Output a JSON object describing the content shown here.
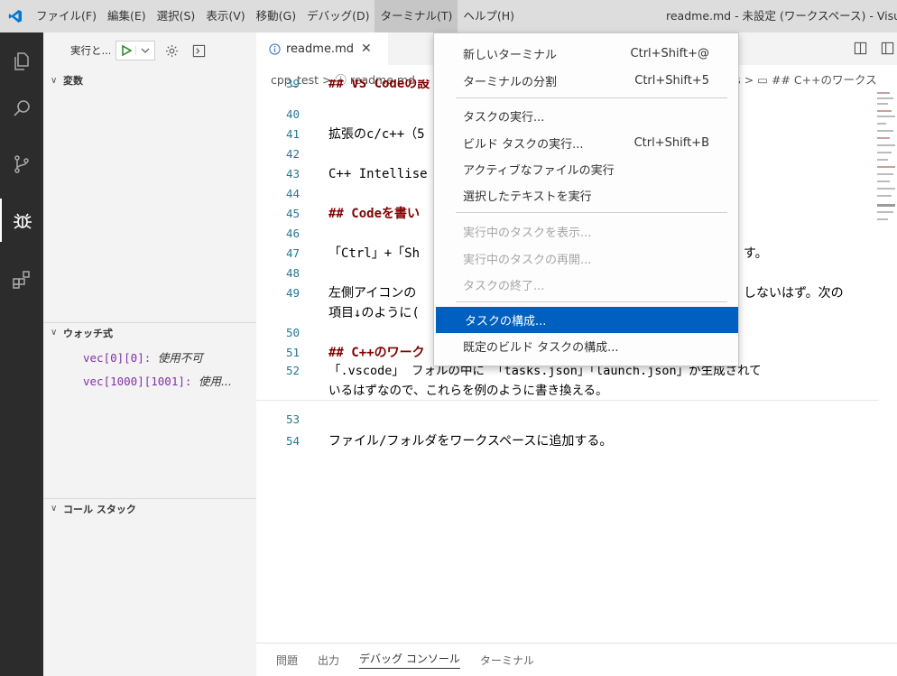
{
  "menubar": {
    "items": [
      "ファイル(F)",
      "編集(E)",
      "選択(S)",
      "表示(V)",
      "移動(G)",
      "デバッグ(D)",
      "ターミナル(T)",
      "ヘルプ(H)"
    ],
    "window_title": "readme.md - 未設定 (ワークスペース) - Visu"
  },
  "sidebar": {
    "run_label": "実行と...",
    "sections": {
      "variables": "変数",
      "watch": "ウォッチ式",
      "callstack": "コール スタック"
    },
    "watch_items": [
      {
        "expr": "vec[0][0]:",
        "value": "使用不可"
      },
      {
        "expr": "vec[1000][1001]:",
        "value": "使用..."
      }
    ]
  },
  "editor": {
    "tab_label": "readme.md",
    "breadcrumb_left": "cpp_test > ⓘ readme.md",
    "breadcrumb_right": "ws > ▭ ## C++のワークス",
    "lines": [
      {
        "n": "39",
        "t": "## VS Codeの設"
      },
      {
        "n": "40",
        "t": ""
      },
      {
        "n": "41",
        "t": "拡張のc/c++（5"
      },
      {
        "n": "42",
        "t": ""
      },
      {
        "n": "43",
        "t": "C++ Intellise"
      },
      {
        "n": "44",
        "t": ""
      },
      {
        "n": "45",
        "t": "## Codeを書い"
      },
      {
        "n": "46",
        "t": ""
      },
      {
        "n": "47",
        "t": "「Ctrl」+「Sh",
        "tail": "す。"
      },
      {
        "n": "48",
        "t": ""
      },
      {
        "n": "49",
        "t": "左側アイコンの",
        "tail": "しないはず。次の"
      },
      {
        "n": "",
        "t": "項目↓のように("
      },
      {
        "n": "50",
        "t": ""
      },
      {
        "n": "51",
        "t": "## C++のワーク"
      },
      {
        "n": "52",
        "t": "「.vscode」 フォルの中に 「tasks.json」「launch.json」が生成されて"
      },
      {
        "n": "",
        "t": "いるはずなので、これらを例のように書き換える。"
      },
      {
        "n": "53",
        "t": ""
      },
      {
        "n": "54",
        "t": "ファイル/フォルダをワークスペースに追加する。"
      }
    ]
  },
  "panel_tabs": [
    "問題",
    "出力",
    "デバッグ コンソール",
    "ターミナル"
  ],
  "dropdown": {
    "items": [
      {
        "label": "新しいターミナル",
        "shortcut": "Ctrl+Shift+@"
      },
      {
        "label": "ターミナルの分割",
        "shortcut": "Ctrl+Shift+5"
      },
      {
        "label": "タスクの実行...",
        "shortcut": ""
      },
      {
        "label": "ビルド タスクの実行...",
        "shortcut": "Ctrl+Shift+B"
      },
      {
        "label": "アクティブなファイルの実行",
        "shortcut": ""
      },
      {
        "label": "選択したテキストを実行",
        "shortcut": ""
      },
      {
        "label": "実行中のタスクを表示...",
        "shortcut": ""
      },
      {
        "label": "実行中のタスクの再開...",
        "shortcut": ""
      },
      {
        "label": "タスクの終了...",
        "shortcut": ""
      },
      {
        "label": "タスクの構成...",
        "shortcut": ""
      },
      {
        "label": "既定のビルド タスクの構成...",
        "shortcut": ""
      }
    ]
  },
  "colors": {
    "accent": "#0060c0",
    "activity_bar": "#2c2c2c",
    "heading_text": "#800000",
    "line_number": "#237893"
  }
}
